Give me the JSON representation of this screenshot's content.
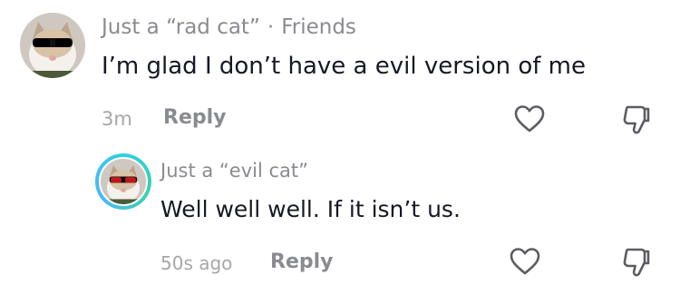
{
  "comment": {
    "author": "Just a “rad cat”",
    "separator": "·",
    "relation": "Friends",
    "text": "I’m glad I don’t have a evil version of me",
    "time": "3m",
    "reply_label": "Reply",
    "avatar_icon": "cat-with-sunglasses-avatar",
    "like_icon": "heart-outline-icon",
    "dislike_icon": "thumbs-down-icon"
  },
  "reply": {
    "author": "Just a “evil cat”",
    "text": "Well well well. If it isn’t us.",
    "time": "50s ago",
    "reply_label": "Reply",
    "avatar_icon": "cat-with-red-glasses-avatar",
    "avatar_ring_color": "#2fd0e0",
    "like_icon": "heart-outline-icon",
    "dislike_icon": "thumbs-down-icon"
  },
  "colors": {
    "primary_text": "#161823",
    "secondary_text": "#8a8b91",
    "time_text": "#a6a7ab",
    "icon_stroke": "#5c5d63"
  }
}
